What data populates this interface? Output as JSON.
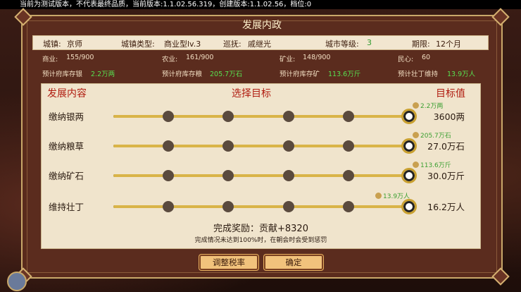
{
  "top_notice": "当前为测试版本，不代表最终品质，当前版本:1.1.02.56.319，创建版本:1.1.02.56，档位:0",
  "panel_title": "发展内政",
  "info": {
    "town_label": "城镇:",
    "town": "京师",
    "type_label": "城镇类型:",
    "type": "商业型lv.3",
    "inspector_label": "巡抚:",
    "inspector": "戚继光",
    "level_label": "城市等级:",
    "level": "3",
    "term_label": "期限:",
    "term": "12个月"
  },
  "stats": {
    "commerce_label": "商业:",
    "commerce": "155/900",
    "agri_label": "农业:",
    "agri": "161/900",
    "mining_label": "矿业:",
    "mining": "148/900",
    "morale_label": "民心:",
    "morale": "60",
    "silver_label": "预计府库存银",
    "silver": "2.2万两",
    "grain_label": "预计府库存粮",
    "grain": "205.7万石",
    "ore_label": "预计府库存矿",
    "ore": "113.6万斤",
    "men_label": "预计壮丁维持",
    "men": "13.9万人"
  },
  "headers": {
    "content": "发展内容",
    "select": "选择目标",
    "target": "目标值"
  },
  "rows": [
    {
      "label": "缴纳银两",
      "tip": "2.2万两",
      "target": "3600两",
      "level": 1.0
    },
    {
      "label": "缴纳粮草",
      "tip": "205.7万石",
      "target": "27.0万石",
      "level": 1.0
    },
    {
      "label": "缴纳矿石",
      "tip": "113.6万斤",
      "target": "30.0万斤",
      "level": 1.0
    },
    {
      "label": "维持壮丁",
      "tip": "13.9万人",
      "target": "16.2万人",
      "level": 1.0
    }
  ],
  "reward": "完成奖励：贡献+8320",
  "note": "完成情况未达到100%时，在朝会时会受到惩罚",
  "buttons": {
    "adjust_tax": "调整税率",
    "confirm": "确定"
  }
}
